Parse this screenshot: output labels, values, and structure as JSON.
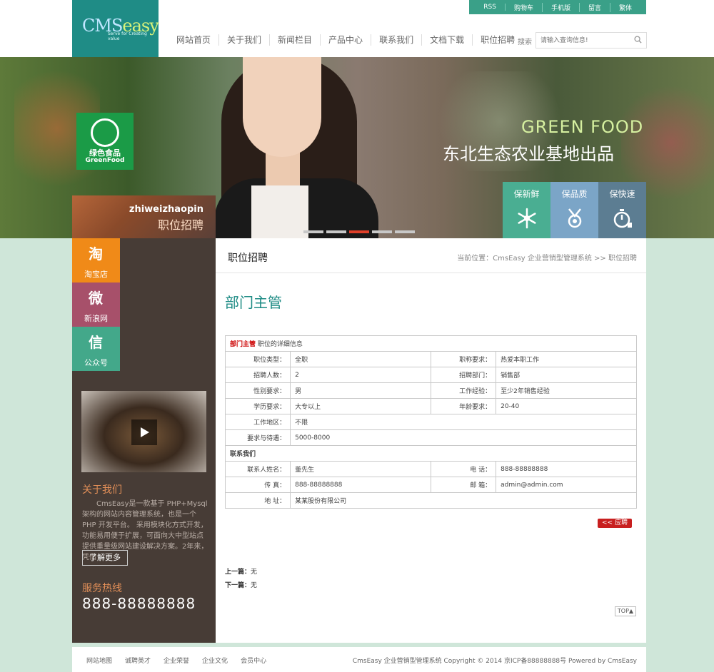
{
  "header": {
    "logo": {
      "main": "CMS",
      "accent": "easy",
      "tagline": "Serve for Creating value"
    },
    "topbar": [
      "RSS",
      "购物车",
      "手机版",
      "留言",
      "繁体"
    ],
    "nav": [
      "网站首页",
      "关于我们",
      "新闻栏目",
      "产品中心",
      "联系我们",
      "文档下载",
      "职位招聘"
    ],
    "search": {
      "label": "搜索",
      "placeholder": "请输入查询信息!"
    }
  },
  "banner": {
    "badge_line1": "绿色食品",
    "badge_line2": "GreenFood",
    "headline_en": "GREEN FOOD",
    "headline_cn": "东北生态农业基地出品",
    "features": [
      "保新鲜",
      "保品质",
      "保快速"
    ],
    "section_en": "zhiweizhaopin",
    "section_cn": "职位招聘",
    "slide_count": 5,
    "active_slide": 3
  },
  "sidebar": {
    "social": [
      {
        "label": "淘宝店",
        "glyph": "淘"
      },
      {
        "label": "新浪网",
        "glyph": "微"
      },
      {
        "label": "公众号",
        "glyph": "信"
      }
    ],
    "about_title": "关于我们",
    "about_text": "CmsEasy是一款基于 PHP+Mysql 架构的网站内容管理系统，也是一个 PHP 开发平台。 采用模块化方式开发，功能易用便于扩展，可面向大中型站点提供重量级网站建设解决方案。2年来，凭借",
    "more_button": "了解更多",
    "hotline_title": "服务热线",
    "hotline_number": "888-88888888"
  },
  "main": {
    "title": "职位招聘",
    "breadcrumb": "当前位置：CmsEasy 企业营销型管理系统  >> 职位招聘",
    "job_title": "部门主管",
    "table": {
      "header_name": "部门主管",
      "header_suffix": "职位的详细信息",
      "rows": [
        {
          "k1": "职位类型：",
          "v1": "全职",
          "k2": "职称要求：",
          "v2": "热爱本职工作"
        },
        {
          "k1": "招聘人数：",
          "v1": "2",
          "k2": "招聘部门：",
          "v2": "销售部"
        },
        {
          "k1": "性别要求：",
          "v1": "男",
          "k2": "工作经验：",
          "v2": "至少2年销售经验"
        },
        {
          "k1": "学历要求：",
          "v1": "大专以上",
          "k2": "年龄要求：",
          "v2": "20-40"
        }
      ],
      "area_label": "工作地区：",
      "area_value": "不限",
      "salary_label": "要求与待遇：",
      "salary_value": "5000-8000",
      "contact_title": "联系我们",
      "contact_rows": [
        {
          "k1": "联系人姓名：",
          "v1": "董先生",
          "k2": "电  话：",
          "v2": "888-88888888"
        },
        {
          "k1": "传  真：",
          "v1": "888-88888888",
          "k2": "邮  箱：",
          "v2": "admin@admin.com"
        }
      ],
      "address_label": "地  址：",
      "address_value": "某某股份有限公司"
    },
    "apply_button": "<<   应聘",
    "prev_label": "上一篇：",
    "prev_value": "无",
    "next_label": "下一篇：",
    "next_value": "无",
    "top_button": "TOP▲"
  },
  "footer": {
    "links": [
      "网站地图",
      "诚聘英才",
      "企业荣誉",
      "企业文化",
      "会员中心"
    ],
    "copyright": "CmsEasy 企业营销型管理系统 Copyright © 2014 京ICP备88888888号 Powered by CmsEasy"
  },
  "colors": {
    "teal": "#1f8c86",
    "orange": "#f08a18",
    "red": "#c81f1f",
    "sidebar": "#473c36"
  }
}
